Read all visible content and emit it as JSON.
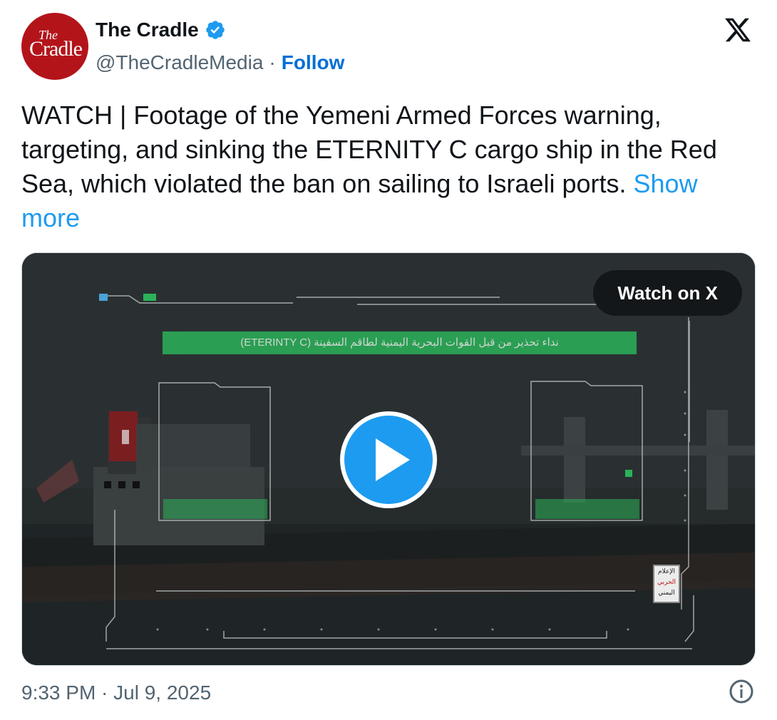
{
  "author": {
    "avatar_text_small": "The",
    "avatar_text_large": "Cradle",
    "display_name": "The Cradle",
    "handle": "@TheCradleMedia",
    "separator": "·",
    "follow_label": "Follow",
    "verified_icon": "verified-badge-icon"
  },
  "platform_logo": "x-logo-icon",
  "tweet": {
    "text": "WATCH | Footage of the Yemeni Armed Forces warning, targeting, and sinking the ETERNITY C cargo ship in the Red Sea, which violated the ban on sailing to Israeli ports.",
    "show_more": "Show more"
  },
  "media": {
    "banner_text": "نداء تحذير من قبل القوات البحرية اليمنية لطاقم السفينة (ETERINTY C)",
    "watch_label": "Watch on X",
    "play_icon": "play-icon",
    "watermark_lines": [
      "الإعلام",
      "الحربي",
      "اليمني"
    ]
  },
  "footer": {
    "timestamp": "9:33 PM · Jul 9, 2025",
    "info_icon": "info-icon"
  },
  "colors": {
    "accent": "#1d9bf0",
    "follow": "#006fd6",
    "avatar": "#b3141a",
    "banner": "#2bb259",
    "muted": "#536471"
  }
}
